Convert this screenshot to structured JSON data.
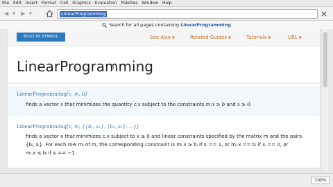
{
  "menu": [
    "File",
    "Edit",
    "Insert",
    "Format",
    "Cell",
    "Graphics",
    "Evaluation",
    "Palettes",
    "Window",
    "Help"
  ],
  "toolbar": {
    "back": "◀",
    "forward": "▶",
    "address_value": "LinearProgramming",
    "zoom": "100%"
  },
  "search": {
    "prefix": "Search for all pages containing ",
    "query": "LinearProgramming"
  },
  "doc": {
    "badge": "BUILT-IN SYMBOL",
    "links": [
      "See Also",
      "Related Guides",
      "Tutorials",
      "URL"
    ],
    "title": "LinearProgramming",
    "u1": {
      "fn": "LinearProgramming",
      "args": "[c, m, b]"
    },
    "d1": [
      "finds a vector ",
      "x",
      " that minimizes the quantity ",
      "c.x",
      " subject to the constraints ",
      "m.x ≥ b",
      " and ",
      "x ≥ 0",
      "."
    ],
    "u2": {
      "fn": "LinearProgramming",
      "args": "[c, m, {{b₁, s₁}, {b₂, s₂}, …}]"
    },
    "d2a": "finds a vector x that minimizes c.x subject to x ≥ 0 and linear constraints specified by the matrix m and the pairs",
    "d2b": "{bᵢ, sᵢ}. For each row mᵢ of m, the corresponding constraint is mᵢ.x ≥ bᵢ if sᵢ == 1, or mᵢ.x == bᵢ if sᵢ == 0, or",
    "d2c": "mᵢ.x ≤ bᵢ if sᵢ == −1."
  },
  "icons": {
    "home": "home-icon",
    "close": "close-icon",
    "search": "search-icon"
  }
}
